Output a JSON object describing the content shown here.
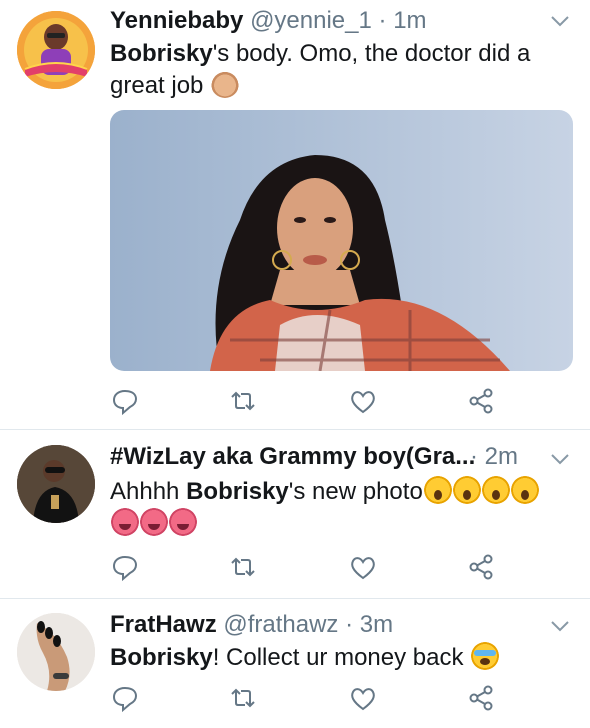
{
  "tweets": [
    {
      "name": "Yenniebaby",
      "handle": "@yennie_1",
      "separator": "·",
      "time": "1m",
      "body_bold": "Bobrisky",
      "body_text": "'s body. Omo, the doctor did a great job",
      "body_emoji": [
        "clapping-hands"
      ],
      "has_media": true
    },
    {
      "name": "#WizLay aka Grammy boy(Gra...",
      "handle": "",
      "separator": "·",
      "time": "2m",
      "body_prefix": "Ahhhh ",
      "body_bold": "Bobrisky",
      "body_text": "'s new photo",
      "body_emoji": [
        "face-screaming-in-fear",
        "face-screaming-in-fear",
        "face-screaming-in-fear",
        "face-screaming-in-fear",
        "hot-face",
        "hot-face",
        "hot-face"
      ]
    },
    {
      "name": "FratHawz",
      "handle": "@frathawz",
      "separator": "·",
      "time": "3m",
      "body_bold": "Bobrisky",
      "body_text": "! Collect ur money back",
      "body_emoji": [
        "loudly-crying-face"
      ]
    }
  ],
  "icons": {
    "reply": "reply-icon",
    "retweet": "retweet-icon",
    "like": "like-icon",
    "share": "share-icon",
    "more": "chevron-down-icon"
  },
  "colors": {
    "text": "#14171a",
    "secondary": "#657786",
    "divider": "#e1e8ed"
  }
}
